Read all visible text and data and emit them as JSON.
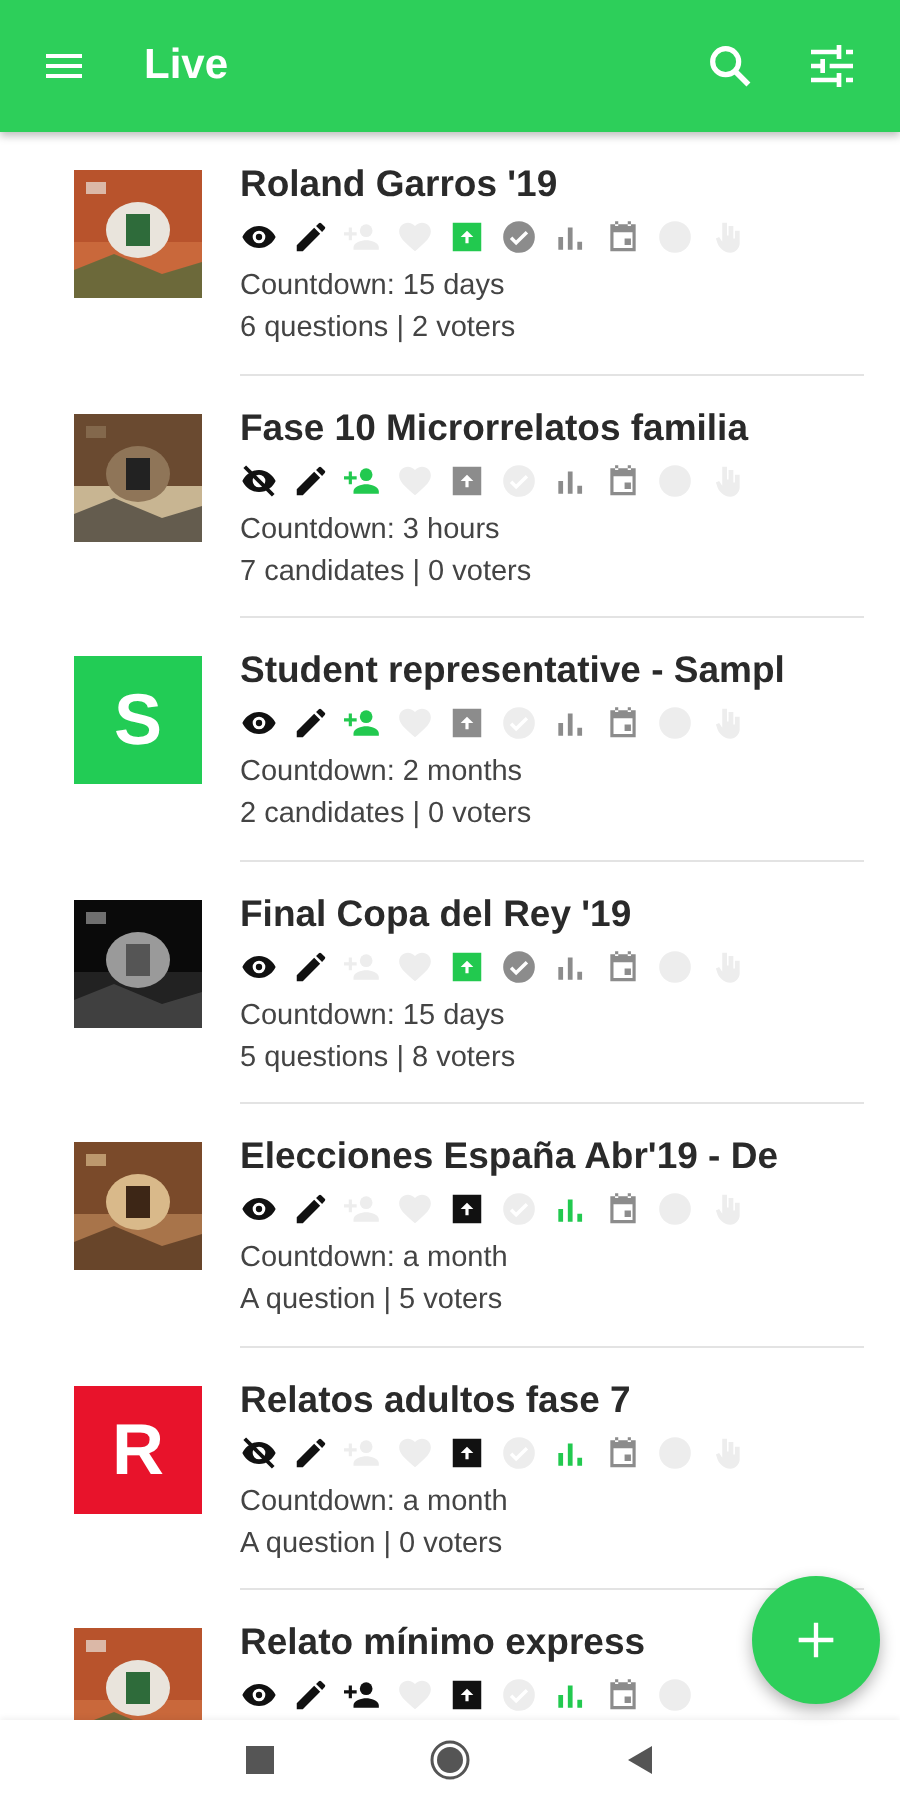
{
  "app_bar": {
    "title": "Live"
  },
  "items": [
    {
      "thumb": {
        "kind": "picture"
      },
      "title": "Roland Garros '19",
      "countdown": "Countdown: 15 days",
      "summary": "6 questions | 2 voters",
      "icons": [
        {
          "kind": "eye",
          "color": "#111111"
        },
        {
          "kind": "pencil",
          "color": "#111111"
        },
        {
          "kind": "person-add",
          "color": "#ededed"
        },
        {
          "kind": "heart",
          "color": "#ededed"
        },
        {
          "kind": "box",
          "color": "#22c94f"
        },
        {
          "kind": "check",
          "color": "#8c8c8c"
        },
        {
          "kind": "chart",
          "color": "#8c8c8c"
        },
        {
          "kind": "calendar",
          "color": "#8c8c8c"
        },
        {
          "kind": "bubble",
          "color": "#ededed"
        },
        {
          "kind": "hand",
          "color": "#ededed"
        }
      ]
    },
    {
      "thumb": {
        "kind": "picture"
      },
      "title": "Fase 10 Microrrelatos familia",
      "countdown": "Countdown: 3 hours",
      "summary": "7 candidates | 0 voters",
      "icons": [
        {
          "kind": "eye-off",
          "color": "#111111"
        },
        {
          "kind": "pencil",
          "color": "#111111"
        },
        {
          "kind": "person-add",
          "color": "#22c94f"
        },
        {
          "kind": "heart",
          "color": "#ededed"
        },
        {
          "kind": "box",
          "color": "#8c8c8c"
        },
        {
          "kind": "check",
          "color": "#ededed"
        },
        {
          "kind": "chart",
          "color": "#8c8c8c"
        },
        {
          "kind": "calendar",
          "color": "#8c8c8c"
        },
        {
          "kind": "bubble",
          "color": "#ededed"
        },
        {
          "kind": "hand",
          "color": "#ededed"
        }
      ]
    },
    {
      "thumb": {
        "kind": "avatar",
        "letter": "S",
        "color": "#22cc55"
      },
      "title": "Student representative - Sampl",
      "countdown": "Countdown: 2 months",
      "summary": "2 candidates | 0 voters",
      "icons": [
        {
          "kind": "eye",
          "color": "#111111"
        },
        {
          "kind": "pencil",
          "color": "#111111"
        },
        {
          "kind": "person-add",
          "color": "#22c94f"
        },
        {
          "kind": "heart",
          "color": "#ededed"
        },
        {
          "kind": "box",
          "color": "#8c8c8c"
        },
        {
          "kind": "check",
          "color": "#ededed"
        },
        {
          "kind": "chart",
          "color": "#8c8c8c"
        },
        {
          "kind": "calendar",
          "color": "#8c8c8c"
        },
        {
          "kind": "bubble",
          "color": "#ededed"
        },
        {
          "kind": "hand",
          "color": "#ededed"
        }
      ]
    },
    {
      "thumb": {
        "kind": "picture"
      },
      "title": "Final Copa del Rey '19",
      "countdown": "Countdown: 15 days",
      "summary": "5 questions | 8 voters",
      "icons": [
        {
          "kind": "eye",
          "color": "#111111"
        },
        {
          "kind": "pencil",
          "color": "#111111"
        },
        {
          "kind": "person-add",
          "color": "#ededed"
        },
        {
          "kind": "heart",
          "color": "#ededed"
        },
        {
          "kind": "box",
          "color": "#22c94f"
        },
        {
          "kind": "check",
          "color": "#8c8c8c"
        },
        {
          "kind": "chart",
          "color": "#8c8c8c"
        },
        {
          "kind": "calendar",
          "color": "#8c8c8c"
        },
        {
          "kind": "bubble",
          "color": "#ededed"
        },
        {
          "kind": "hand",
          "color": "#ededed"
        }
      ]
    },
    {
      "thumb": {
        "kind": "picture"
      },
      "title": "Elecciones España Abr'19 - De",
      "countdown": "Countdown: a month",
      "summary": "A question | 5 voters",
      "icons": [
        {
          "kind": "eye",
          "color": "#111111"
        },
        {
          "kind": "pencil",
          "color": "#111111"
        },
        {
          "kind": "person-add",
          "color": "#ededed"
        },
        {
          "kind": "heart",
          "color": "#ededed"
        },
        {
          "kind": "box",
          "color": "#111111"
        },
        {
          "kind": "check",
          "color": "#ededed"
        },
        {
          "kind": "chart",
          "color": "#22c94f"
        },
        {
          "kind": "calendar",
          "color": "#8c8c8c"
        },
        {
          "kind": "bubble",
          "color": "#ededed"
        },
        {
          "kind": "hand",
          "color": "#ededed"
        }
      ]
    },
    {
      "thumb": {
        "kind": "avatar",
        "letter": "R",
        "color": "#e8132b"
      },
      "title": "Relatos adultos fase 7",
      "countdown": "Countdown: a month",
      "summary": "A question | 0 voters",
      "icons": [
        {
          "kind": "eye-off",
          "color": "#111111"
        },
        {
          "kind": "pencil",
          "color": "#111111"
        },
        {
          "kind": "person-add",
          "color": "#ededed"
        },
        {
          "kind": "heart",
          "color": "#ededed"
        },
        {
          "kind": "box",
          "color": "#111111"
        },
        {
          "kind": "check",
          "color": "#ededed"
        },
        {
          "kind": "chart",
          "color": "#22c94f"
        },
        {
          "kind": "calendar",
          "color": "#8c8c8c"
        },
        {
          "kind": "bubble",
          "color": "#ededed"
        },
        {
          "kind": "hand",
          "color": "#ededed"
        }
      ]
    },
    {
      "thumb": {
        "kind": "picture"
      },
      "title": "Relato mínimo express",
      "icons": [
        {
          "kind": "eye",
          "color": "#111111"
        },
        {
          "kind": "pencil",
          "color": "#111111"
        },
        {
          "kind": "person-add",
          "color": "#111111"
        },
        {
          "kind": "heart",
          "color": "#ededed"
        },
        {
          "kind": "box",
          "color": "#111111"
        },
        {
          "kind": "check",
          "color": "#ededed"
        },
        {
          "kind": "chart",
          "color": "#22c94f"
        },
        {
          "kind": "calendar",
          "color": "#8c8c8c"
        },
        {
          "kind": "bubble",
          "color": "#ededed"
        }
      ]
    }
  ]
}
